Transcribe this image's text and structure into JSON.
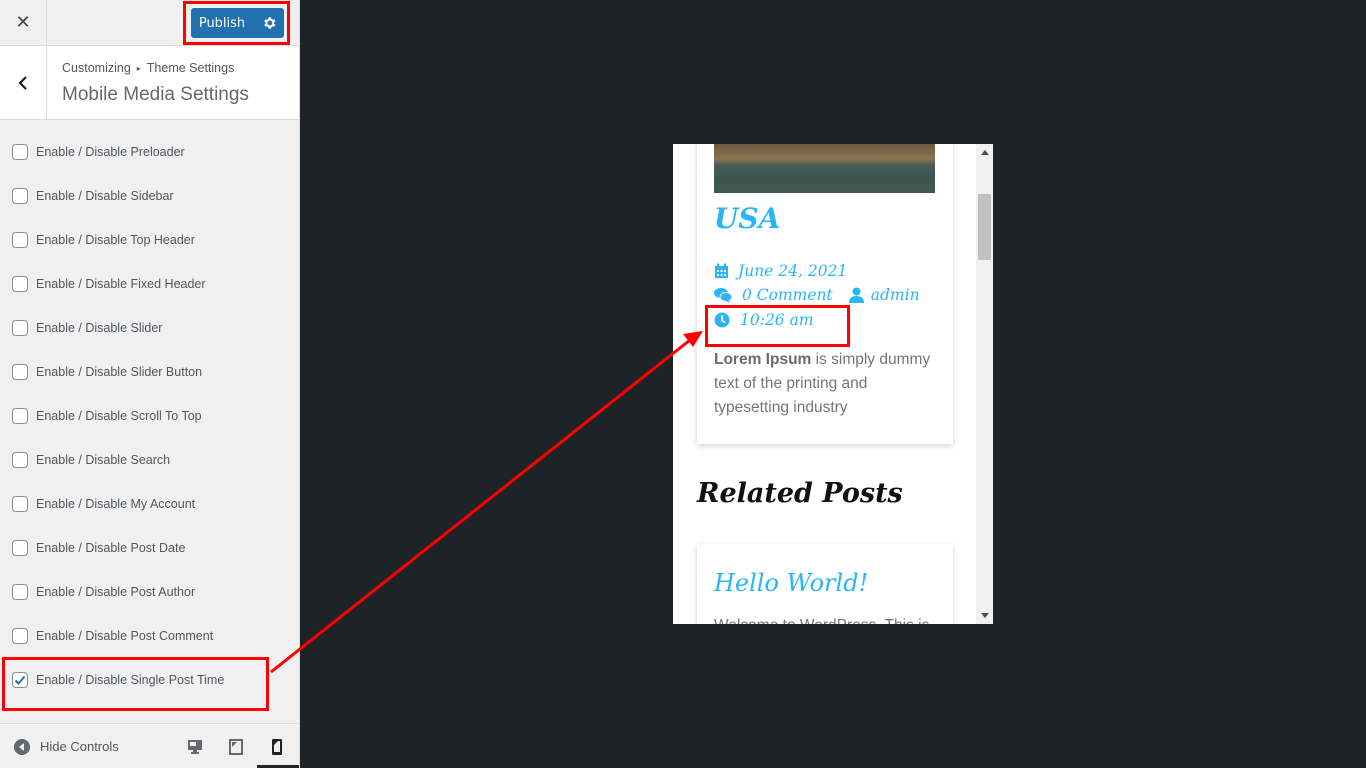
{
  "topbar": {
    "close_label": "✕",
    "publish_label": "Publish"
  },
  "titlebar": {
    "breadcrumb_root": "Customizing",
    "breadcrumb_sep": "▸",
    "breadcrumb_parent": "Theme Settings",
    "section_title": "Mobile Media Settings"
  },
  "controls": [
    {
      "label": "Enable / Disable Preloader",
      "checked": false
    },
    {
      "label": "Enable / Disable Sidebar",
      "checked": false
    },
    {
      "label": "Enable / Disable Top Header",
      "checked": false
    },
    {
      "label": "Enable / Disable Fixed Header",
      "checked": false
    },
    {
      "label": "Enable / Disable Slider",
      "checked": false
    },
    {
      "label": "Enable / Disable Slider Button",
      "checked": false
    },
    {
      "label": "Enable / Disable Scroll To Top",
      "checked": false
    },
    {
      "label": "Enable / Disable Search",
      "checked": false
    },
    {
      "label": "Enable / Disable My Account",
      "checked": false
    },
    {
      "label": "Enable / Disable Post Date",
      "checked": false
    },
    {
      "label": "Enable / Disable Post Author",
      "checked": false
    },
    {
      "label": "Enable / Disable Post Comment",
      "checked": false
    },
    {
      "label": "Enable / Disable Single Post Time",
      "checked": true
    }
  ],
  "footer": {
    "hide_controls_label": "Hide Controls",
    "devices": [
      "desktop",
      "tablet",
      "mobile"
    ],
    "active_device": "mobile"
  },
  "preview": {
    "post": {
      "title": "USA",
      "date": "June 24, 2021",
      "comments": "0 Comment",
      "author": "admin",
      "time": "10:26 am",
      "excerpt_bold": "Lorem Ipsum",
      "excerpt_rest": " is simply dummy text of the printing and typesetting industry"
    },
    "related_heading": "Related Posts",
    "related_posts": [
      {
        "title": "Hello World!",
        "excerpt_partial": "Welcome to WordPress. This is"
      }
    ]
  },
  "colors": {
    "accent": "#29b6f6",
    "publish_bg": "#2271b1",
    "annotation": "#ff0000",
    "backdrop": "#1d2327"
  }
}
